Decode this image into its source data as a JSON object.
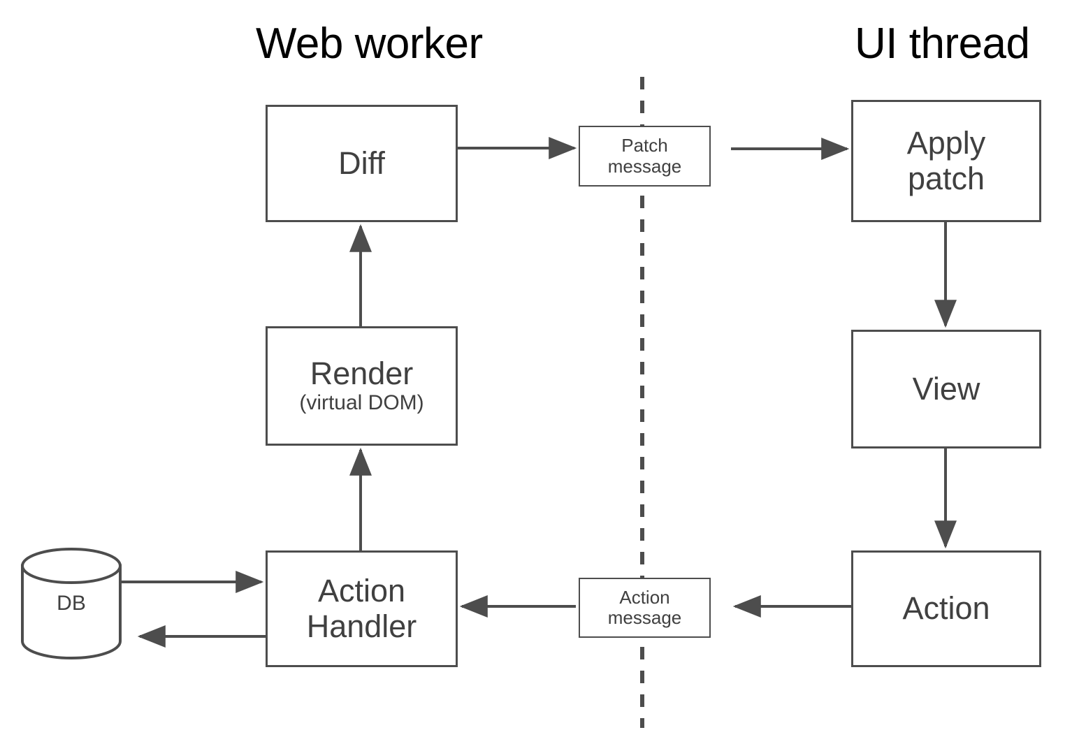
{
  "diagram": {
    "title_left": "Web worker",
    "title_right": "UI thread",
    "divider": "dashed-vertical-divider",
    "stroke_color": "#4d4d4d",
    "text_color": "#404040",
    "background": "#ffffff",
    "nodes": {
      "diff": {
        "label": "Diff"
      },
      "render": {
        "label": "Render",
        "sublabel": "(virtual DOM)"
      },
      "action_handler": {
        "line1": "Action",
        "line2": "Handler"
      },
      "db": {
        "label": "DB"
      },
      "patch_message": {
        "line1": "Patch",
        "line2": "message"
      },
      "action_message": {
        "line1": "Action",
        "line2": "message"
      },
      "apply_patch": {
        "line1": "Apply",
        "line2": "patch"
      },
      "view": {
        "label": "View"
      },
      "action": {
        "label": "Action"
      }
    },
    "edges": [
      {
        "id": "diff-to-patch-message",
        "from": "diff",
        "to": "patch_message",
        "direction": "right"
      },
      {
        "id": "patch-message-to-apply-patch",
        "from": "patch_message",
        "to": "apply_patch",
        "direction": "right"
      },
      {
        "id": "apply-patch-to-view",
        "from": "apply_patch",
        "to": "view",
        "direction": "down"
      },
      {
        "id": "view-to-action",
        "from": "view",
        "to": "action",
        "direction": "down"
      },
      {
        "id": "action-to-action-message",
        "from": "action",
        "to": "action_message",
        "direction": "left"
      },
      {
        "id": "action-message-to-action-handler",
        "from": "action_message",
        "to": "action_handler",
        "direction": "left"
      },
      {
        "id": "action-handler-to-render",
        "from": "action_handler",
        "to": "render",
        "direction": "up"
      },
      {
        "id": "render-to-diff",
        "from": "render",
        "to": "diff",
        "direction": "up"
      },
      {
        "id": "db-to-action-handler",
        "from": "db",
        "to": "action_handler",
        "direction": "right"
      },
      {
        "id": "action-handler-to-db",
        "from": "action_handler",
        "to": "db",
        "direction": "left"
      }
    ]
  }
}
